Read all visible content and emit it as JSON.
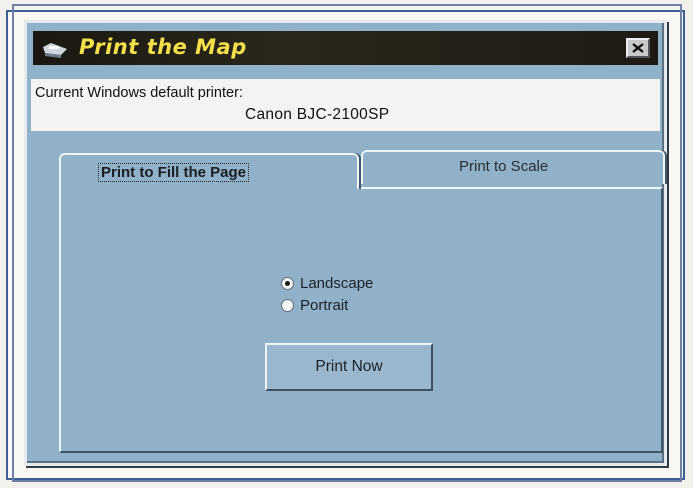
{
  "window": {
    "title": "Print the Map",
    "icon": "printer-icon",
    "close_glyph": "×"
  },
  "printer": {
    "label": "Current Windows default printer:",
    "name": "Canon BJC-2100SP"
  },
  "tabs": [
    {
      "label": "Print to Fill the Page",
      "active": true
    },
    {
      "label": "Print to Scale",
      "active": false
    }
  ],
  "orientation": {
    "options": [
      {
        "label": "Landscape",
        "selected": true
      },
      {
        "label": "Portrait",
        "selected": false
      }
    ]
  },
  "actions": {
    "print_now": "Print Now"
  },
  "colors": {
    "dialog_bg": "#91b1c9",
    "titlebar_bg": "#1a1810",
    "title_text": "#f4e04a",
    "page_border": "#3d5f93"
  }
}
